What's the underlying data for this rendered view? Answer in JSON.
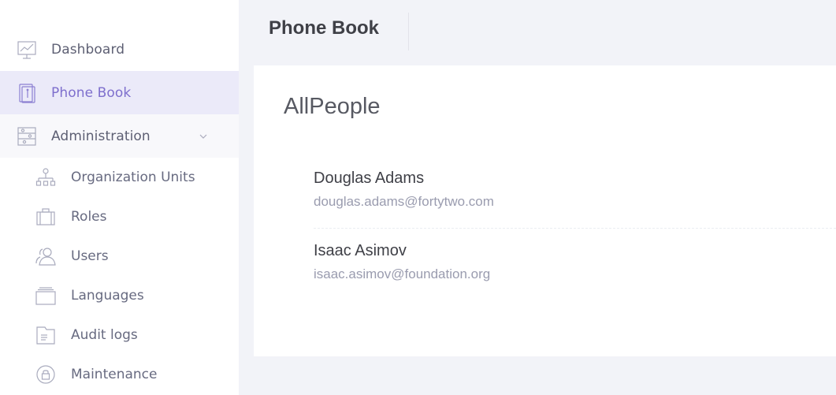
{
  "sidebar": {
    "items": [
      {
        "label": "Dashboard",
        "icon": "dashboard-chart-icon"
      },
      {
        "label": "Phone Book",
        "icon": "phone-book-icon",
        "active": true
      },
      {
        "label": "Administration",
        "icon": "sliders-icon",
        "expanded": true
      }
    ],
    "admin_items": [
      {
        "label": "Organization Units",
        "icon": "org-tree-icon"
      },
      {
        "label": "Roles",
        "icon": "briefcase-icon"
      },
      {
        "label": "Users",
        "icon": "users-icon"
      },
      {
        "label": "Languages",
        "icon": "layers-icon"
      },
      {
        "label": "Audit logs",
        "icon": "document-icon"
      },
      {
        "label": "Maintenance",
        "icon": "lock-cycle-icon"
      }
    ]
  },
  "header": {
    "title": "Phone Book"
  },
  "card": {
    "title": "AllPeople",
    "people": [
      {
        "name": "Douglas Adams",
        "email": "douglas.adams@fortytwo.com"
      },
      {
        "name": "Isaac Asimov",
        "email": "isaac.asimov@foundation.org"
      }
    ]
  },
  "colors": {
    "accent": "#7e6fcd",
    "active_bg": "#ebeaf9",
    "page_bg": "#f2f3f8",
    "text_primary": "#3f4047",
    "text_muted": "#9a9caf"
  }
}
